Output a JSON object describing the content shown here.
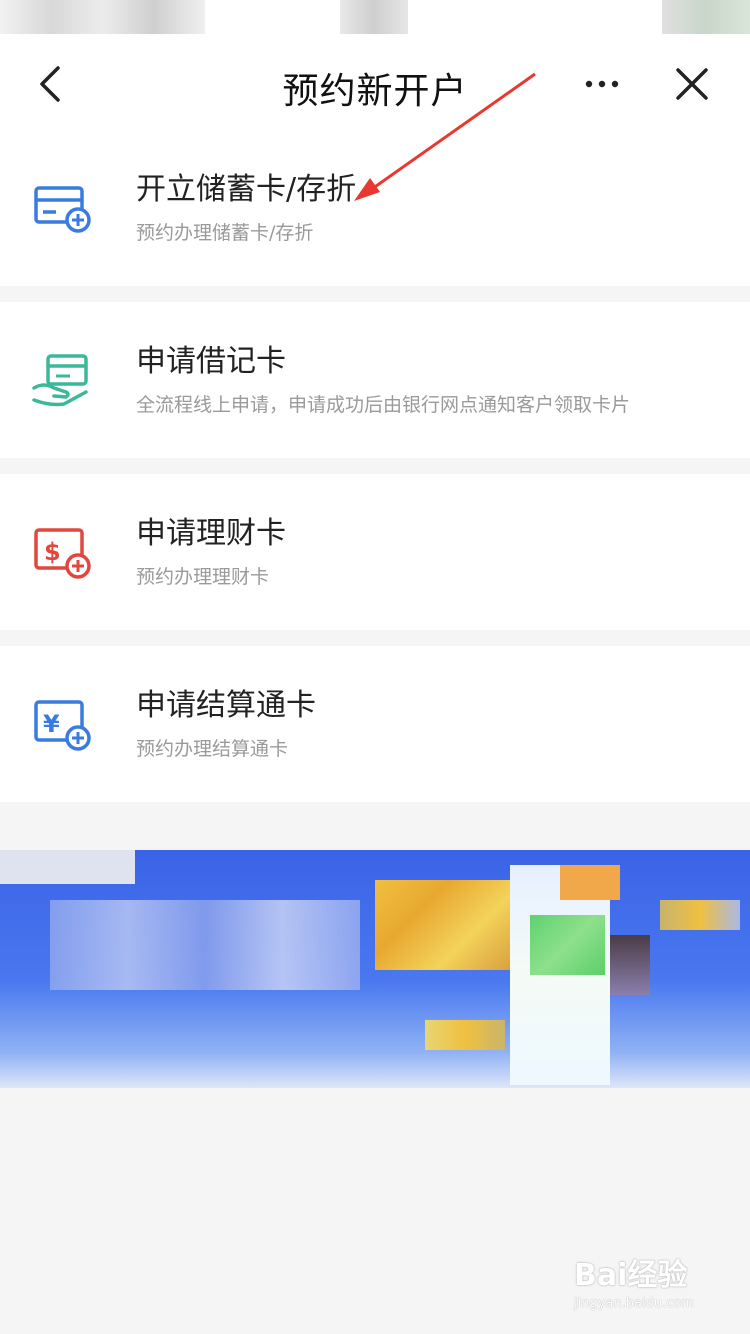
{
  "header": {
    "title": "预约新开户",
    "back_icon": "chevron-left-icon",
    "more_icon": "more-horizontal-icon",
    "close_icon": "close-icon"
  },
  "items": [
    {
      "title": "开立储蓄卡/存折",
      "description": "预约办理储蓄卡/存折",
      "icon": "card-add-icon",
      "icon_color": "#3a7be0"
    },
    {
      "title": "申请借记卡",
      "description": "全流程线上申请，申请成功后由银行网点通知客户领取卡片",
      "icon": "hand-card-icon",
      "icon_color": "#3bb89a"
    },
    {
      "title": "申请理财卡",
      "description": "预约办理理财卡",
      "icon": "dollar-card-add-icon",
      "icon_color": "#e0483f"
    },
    {
      "title": "申请结算通卡",
      "description": "预约办理结算通卡",
      "icon": "yuan-card-add-icon",
      "icon_color": "#3a7be0"
    }
  ],
  "annotation": {
    "arrow_color": "#e8382f"
  },
  "watermark": {
    "logo": "Bai经验",
    "url": "jingyan.baidu.com"
  }
}
